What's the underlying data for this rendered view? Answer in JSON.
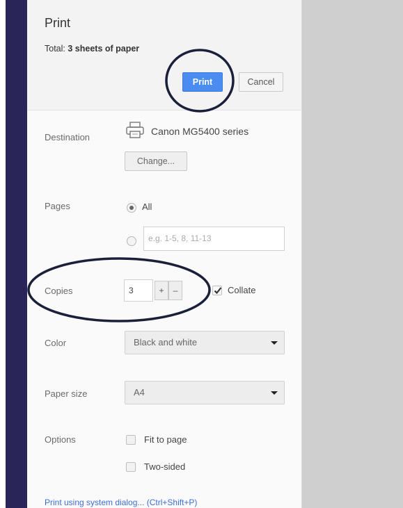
{
  "header": {
    "title": "Print",
    "total_prefix": "Total: ",
    "total_value": "3 sheets of paper"
  },
  "buttons": {
    "print": "Print",
    "cancel": "Cancel",
    "change": "Change..."
  },
  "destination": {
    "label": "Destination",
    "printer_name": "Canon MG5400 series",
    "icon": "printer-icon"
  },
  "pages": {
    "label": "Pages",
    "all_label": "All",
    "all_selected": true,
    "custom_placeholder": "e.g. 1-5, 8, 11-13"
  },
  "copies": {
    "label": "Copies",
    "value": "3",
    "plus": "+",
    "minus": "–",
    "collate_label": "Collate",
    "collate_checked": true
  },
  "color": {
    "label": "Color",
    "selected": "Black and white"
  },
  "paper_size": {
    "label": "Paper size",
    "selected": "A4"
  },
  "options": {
    "label": "Options",
    "fit_to_page": "Fit to page",
    "two_sided": "Two-sided"
  },
  "footer": {
    "system_dialog_link": "Print using system dialog... (Ctrl+Shift+P)"
  },
  "colors": {
    "accent": "#4a8cf0",
    "nav_strip": "#2a2558",
    "annotation": "#1a1f3a"
  }
}
